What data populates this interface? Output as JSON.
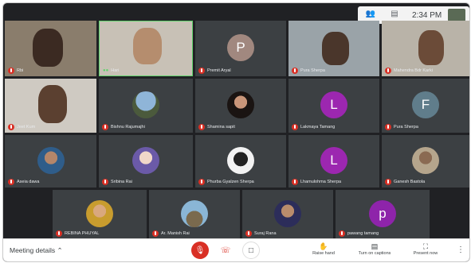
{
  "topbar": {
    "people_icon": "people-icon",
    "chat_icon": "chat-icon",
    "time": "2:34 PM"
  },
  "participants": {
    "p1": "Rbi",
    "p2": "Hari",
    "p3": {
      "name": "Premit Aryal",
      "letter": "P",
      "color": "#a1887f"
    },
    "p4": "Pura Sherpa",
    "p5": "Mahendra Bdr Karki",
    "p6": "Jeet Kum",
    "p7": "Bishnu Rajumajhi",
    "p8": "Shamina sapit",
    "p9": {
      "name": "Lakmaya Tamang",
      "letter": "L",
      "color": "#9c27b0"
    },
    "p10": {
      "name": "Pura Sherpa",
      "letter": "F",
      "color": "#607d8b"
    },
    "p11": "Aseia dawa",
    "p12": "Sribina Rai",
    "p13": "Phurba Gyalzen Sherpa",
    "p14": {
      "name": "Lhamulohma Sherpa",
      "letter": "L",
      "color": "#9c27b0"
    },
    "p15": "Ganesh Bastola",
    "p16": "REBINA PHUYAL",
    "p17": "Ar. Manish Rai",
    "p18": "Suraj Rana",
    "p19": {
      "name": "pawang tamang",
      "letter": "p",
      "color": "#8e24aa"
    }
  },
  "bottombar": {
    "meeting_details": "Meeting details",
    "raise_hand": "Raise hand",
    "captions": "Turn on captions",
    "present": "Present now"
  }
}
